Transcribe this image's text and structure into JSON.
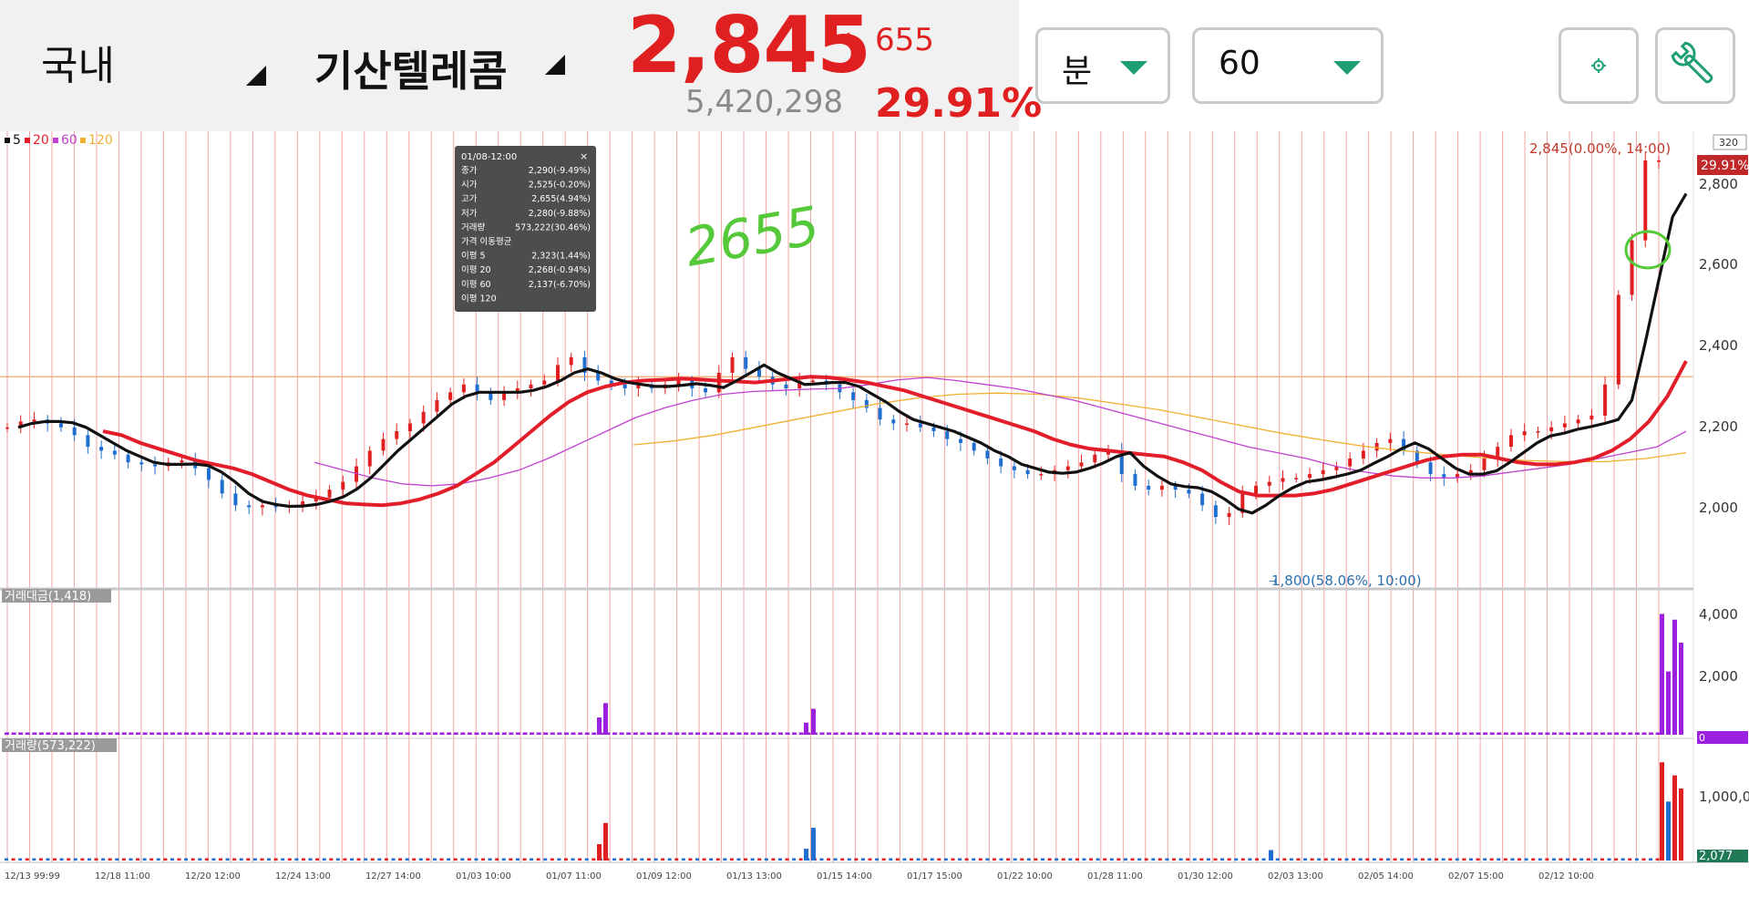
{
  "header": {
    "market": "국내",
    "stock_name": "기산텔레콤",
    "price": "2,845",
    "arrow": "↑",
    "change": "655",
    "volume": "5,420,298",
    "change_pct": "29.91%",
    "interval_unit": "분",
    "interval_value": "60",
    "settings_icon": "gear-icon",
    "tool_icon": "wrench-icon"
  },
  "colors": {
    "up": "#e02020",
    "down": "#1f6fd0",
    "ma5": "#111111",
    "ma20": "#e31e2b",
    "ma60": "#c040d0",
    "ma120": "#f0b030",
    "vertical_grid": "#f3a5a5",
    "volume_purple": "#9b20e0",
    "accent_green": "#1f9e72"
  },
  "legend": [
    "5",
    "20",
    "60",
    "120"
  ],
  "tooltip": {
    "title": "01/08-12:00",
    "close_symbol": "×",
    "rows": [
      {
        "label": "종가",
        "value": "2,290(-9.49%)"
      },
      {
        "label": "시가",
        "value": "2,525(-0.20%)"
      },
      {
        "label": "고가",
        "value": "2,655(4.94%)"
      },
      {
        "label": "저가",
        "value": "2,280(-9.88%)"
      },
      {
        "label": "거래량",
        "value": "573,222(30.46%)"
      },
      {
        "label": "가격 이동평균",
        "value": ""
      },
      {
        "label": "이평 5",
        "value": "2,323(1.44%)"
      },
      {
        "label": "이평 20",
        "value": "2,268(-0.94%)"
      },
      {
        "label": "이평 60",
        "value": "2,137(-6.70%)"
      },
      {
        "label": "이평 120",
        "value": ""
      }
    ]
  },
  "annotations": {
    "max_label": "2,845(0.00%, 14:00)",
    "min_label": "1,800(58.06%, 10:00)",
    "last_price_badge": "29.91%",
    "top_badge": "320",
    "handwritten": "2655",
    "value_badge_1": "0",
    "value_badge_2": "2,077"
  },
  "panels": {
    "amount_title": "거래대금(1,418)",
    "volume_title": "거래량(573,222)"
  },
  "chart_data": {
    "type": "candlestick",
    "interval": "60 minutes",
    "price_ylim": [
      1750,
      2920
    ],
    "price_yticks": [
      "2,000",
      "2,200",
      "2,400",
      "2,600",
      "2,800"
    ],
    "amount_yticks": [
      "2,000",
      "4,000"
    ],
    "volume_yticks": [
      "1,000,0"
    ],
    "x_tick_labels": [
      "12/13 99:99",
      "12/18 11:00",
      "12/20 12:00",
      "12/24 13:00",
      "12/27 14:00",
      "01/03 10:00",
      "01/07 11:00",
      "01/09 12:00",
      "01/13 13:00",
      "01/15 14:00",
      "01/17 15:00",
      "01/22 10:00",
      "01/28 11:00",
      "01/30 12:00",
      "02/03 13:00",
      "02/05 14:00",
      "02/07 15:00",
      "02/12 10:00"
    ],
    "reference_price": 2290,
    "close_series": [
      2160,
      2175,
      2180,
      2170,
      2160,
      2140,
      2110,
      2100,
      2090,
      2070,
      2065,
      2060,
      2070,
      2075,
      2055,
      2025,
      1990,
      1960,
      1955,
      1960,
      1955,
      1960,
      1970,
      1980,
      2000,
      2020,
      2060,
      2100,
      2130,
      2150,
      2170,
      2200,
      2230,
      2250,
      2270,
      2250,
      2230,
      2250,
      2260,
      2270,
      2280,
      2320,
      2340,
      2300,
      2280,
      2270,
      2260,
      2270,
      2260,
      2270,
      2280,
      2260,
      2250,
      2300,
      2340,
      2310,
      2290,
      2270,
      2260,
      2280,
      2280,
      2270,
      2250,
      2230,
      2210,
      2180,
      2170,
      2170,
      2160,
      2150,
      2130,
      2120,
      2100,
      2080,
      2060,
      2050,
      2040,
      2040,
      2050,
      2060,
      2070,
      2090,
      2100,
      2040,
      2010,
      2000,
      2010,
      2000,
      1990,
      1960,
      1930,
      1940,
      1990,
      2010,
      2020,
      2030,
      2030,
      2040,
      2050,
      2060,
      2080,
      2100,
      2120,
      2130,
      2100,
      2070,
      2040,
      2030,
      2040,
      2050,
      2080,
      2110,
      2140,
      2150,
      2150,
      2160,
      2170,
      2180,
      2190,
      2270,
      2500,
      2640,
      2845,
      2845
    ],
    "ma5": [
      2160,
      2170,
      2175,
      2175,
      2172,
      2160,
      2140,
      2120,
      2100,
      2085,
      2070,
      2065,
      2065,
      2066,
      2062,
      2045,
      2020,
      1990,
      1970,
      1962,
      1957,
      1958,
      1962,
      1970,
      1982,
      2002,
      2030,
      2065,
      2100,
      2130,
      2160,
      2190,
      2220,
      2240,
      2250,
      2250,
      2250,
      2250,
      2255,
      2265,
      2280,
      2300,
      2310,
      2300,
      2285,
      2275,
      2270,
      2265,
      2265,
      2268,
      2272,
      2268,
      2262,
      2280,
      2300,
      2320,
      2300,
      2285,
      2270,
      2272,
      2275,
      2275,
      2265,
      2245,
      2225,
      2200,
      2180,
      2170,
      2160,
      2150,
      2135,
      2120,
      2100,
      2085,
      2065,
      2055,
      2045,
      2042,
      2045,
      2055,
      2068,
      2085,
      2095,
      2060,
      2035,
      2015,
      2008,
      2005,
      1995,
      1975,
      1950,
      1940,
      1960,
      1985,
      2005,
      2020,
      2025,
      2032,
      2040,
      2050,
      2068,
      2085,
      2105,
      2120,
      2105,
      2080,
      2055,
      2040,
      2040,
      2048,
      2070,
      2095,
      2120,
      2138,
      2145,
      2155,
      2162,
      2170,
      2180,
      2230,
      2380,
      2540,
      2700,
      2760
    ],
    "ma20": [
      2150,
      2140,
      2120,
      2105,
      2090,
      2075,
      2065,
      2055,
      2040,
      2020,
      2000,
      1985,
      1975,
      1965,
      1962,
      1960,
      1965,
      1975,
      1990,
      2010,
      2040,
      2070,
      2110,
      2150,
      2190,
      2225,
      2250,
      2265,
      2275,
      2280,
      2282,
      2285,
      2283,
      2280,
      2278,
      2275,
      2280,
      2285,
      2290,
      2288,
      2282,
      2275,
      2265,
      2255,
      2240,
      2225,
      2210,
      2195,
      2180,
      2165,
      2150,
      2130,
      2115,
      2105,
      2100,
      2095,
      2090,
      2085,
      2070,
      2050,
      2020,
      1995,
      1985,
      1985,
      1985,
      1990,
      2000,
      2015,
      2030,
      2045,
      2060,
      2075,
      2085,
      2090,
      2090,
      2080,
      2070,
      2065,
      2065,
      2070,
      2080,
      2100,
      2130,
      2175,
      2240,
      2330
    ],
    "ma60": [
      2070,
      2050,
      2030,
      2015,
      2010,
      2015,
      2030,
      2050,
      2080,
      2115,
      2150,
      2185,
      2210,
      2230,
      2245,
      2252,
      2255,
      2258,
      2260,
      2270,
      2282,
      2288,
      2280,
      2270,
      2260,
      2245,
      2230,
      2210,
      2190,
      2170,
      2150,
      2130,
      2110,
      2095,
      2080,
      2060,
      2045,
      2035,
      2030,
      2030,
      2035,
      2045,
      2055,
      2065,
      2080,
      2095,
      2110,
      2150
    ],
    "ma120": [
      2115,
      2125,
      2140,
      2160,
      2180,
      2200,
      2220,
      2235,
      2245,
      2248,
      2245,
      2235,
      2220,
      2205,
      2185,
      2165,
      2145,
      2128,
      2112,
      2100,
      2090,
      2082,
      2075,
      2072,
      2072,
      2080,
      2095
    ],
    "amount_peaks": [
      {
        "at": "01/08 12:00",
        "value": 1100
      },
      {
        "at": "01/15 10:00",
        "value": 900
      },
      {
        "at": "02/13",
        "value": 4200
      }
    ],
    "volume_peaks": [
      {
        "at": "01/08 12:00",
        "value": 573222
      },
      {
        "at": "01/15 10:00",
        "value": 500000
      },
      {
        "at": "02/13",
        "value": 1500000
      }
    ]
  }
}
